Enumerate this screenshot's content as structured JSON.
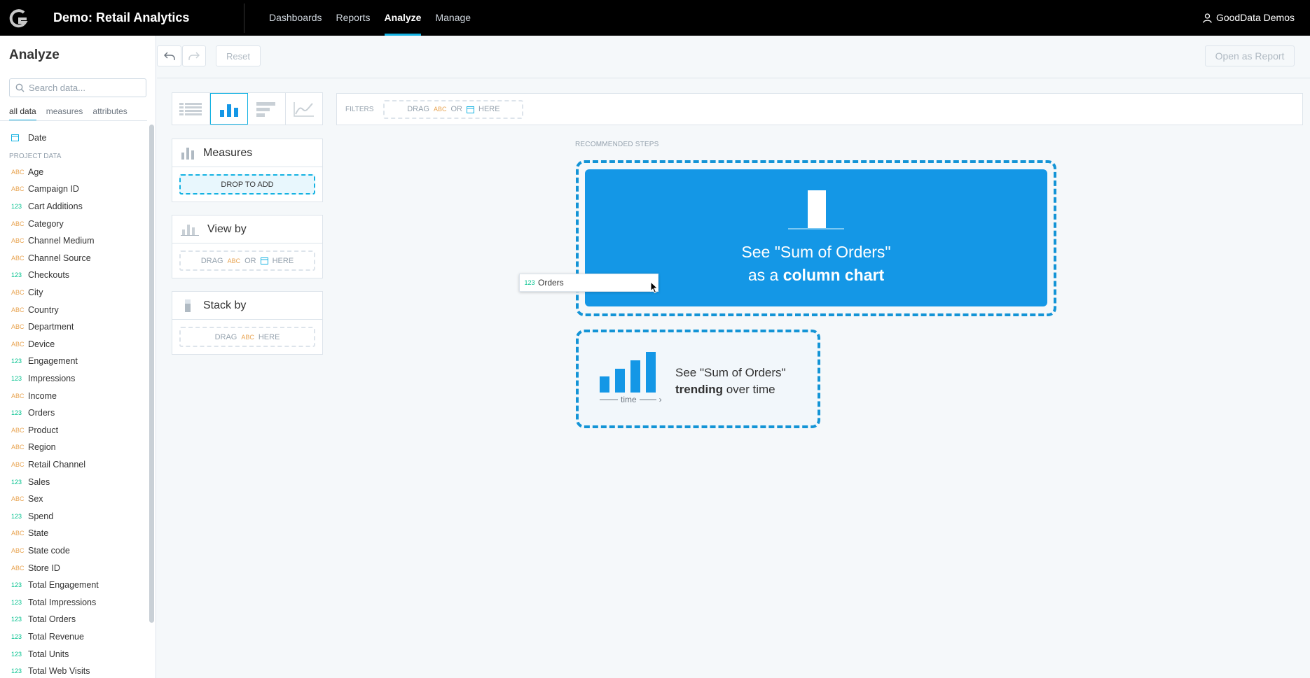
{
  "app": {
    "title": "Demo: Retail Analytics",
    "user": "GoodData Demos",
    "nav": [
      "Dashboards",
      "Reports",
      "Analyze",
      "Manage"
    ],
    "active_nav": "Analyze"
  },
  "toolbar": {
    "reset_label": "Reset",
    "open_report_label": "Open as Report"
  },
  "sidebar": {
    "title": "Analyze",
    "search_placeholder": "Search data...",
    "tabs": [
      "all data",
      "measures",
      "attributes"
    ],
    "date_label": "Date",
    "section_label": "PROJECT DATA",
    "items": [
      {
        "type": "ABC",
        "label": "Age"
      },
      {
        "type": "ABC",
        "label": "Campaign ID"
      },
      {
        "type": "123",
        "label": "Cart Additions"
      },
      {
        "type": "ABC",
        "label": "Category"
      },
      {
        "type": "ABC",
        "label": "Channel Medium"
      },
      {
        "type": "ABC",
        "label": "Channel Source"
      },
      {
        "type": "123",
        "label": "Checkouts"
      },
      {
        "type": "ABC",
        "label": "City"
      },
      {
        "type": "ABC",
        "label": "Country"
      },
      {
        "type": "ABC",
        "label": "Department"
      },
      {
        "type": "ABC",
        "label": "Device"
      },
      {
        "type": "123",
        "label": "Engagement"
      },
      {
        "type": "123",
        "label": "Impressions"
      },
      {
        "type": "ABC",
        "label": "Income"
      },
      {
        "type": "123",
        "label": "Orders"
      },
      {
        "type": "ABC",
        "label": "Product"
      },
      {
        "type": "ABC",
        "label": "Region"
      },
      {
        "type": "ABC",
        "label": "Retail Channel"
      },
      {
        "type": "123",
        "label": "Sales"
      },
      {
        "type": "ABC",
        "label": "Sex"
      },
      {
        "type": "123",
        "label": "Spend"
      },
      {
        "type": "ABC",
        "label": "State"
      },
      {
        "type": "ABC",
        "label": "State code"
      },
      {
        "type": "ABC",
        "label": "Store ID"
      },
      {
        "type": "123",
        "label": "Total Engagement"
      },
      {
        "type": "123",
        "label": "Total Impressions"
      },
      {
        "type": "123",
        "label": "Total Orders"
      },
      {
        "type": "123",
        "label": "Total Revenue"
      },
      {
        "type": "123",
        "label": "Total Units"
      },
      {
        "type": "123",
        "label": "Total Web Visits"
      }
    ]
  },
  "buckets": {
    "measures": {
      "title": "Measures",
      "drop": "DROP TO ADD"
    },
    "view_by": {
      "title": "View by",
      "drag": "DRAG",
      "or": "OR",
      "here": "HERE",
      "abc": "ABC"
    },
    "stack_by": {
      "title": "Stack by",
      "drag": "DRAG",
      "here": "HERE",
      "abc": "ABC"
    }
  },
  "filters": {
    "label": "FILTERS",
    "drag": "DRAG",
    "abc": "ABC",
    "or": "OR",
    "here": "HERE"
  },
  "recommended": {
    "label": "RECOMMENDED STEPS",
    "primary_line1": "See \"Sum of Orders\"",
    "primary_line2_pre": "as a ",
    "primary_line2_bold": "column chart",
    "secondary_line1": "See \"Sum of Orders\"",
    "secondary_bold": "trending",
    "secondary_rest": " over time",
    "time_label": "time"
  },
  "drag_ghost": {
    "type": "123",
    "label": "Orders"
  },
  "colors": {
    "accent": "#14b2e2",
    "primary_blue": "#1497e6",
    "abc": "#e8a452",
    "numeric": "#00c18d"
  }
}
